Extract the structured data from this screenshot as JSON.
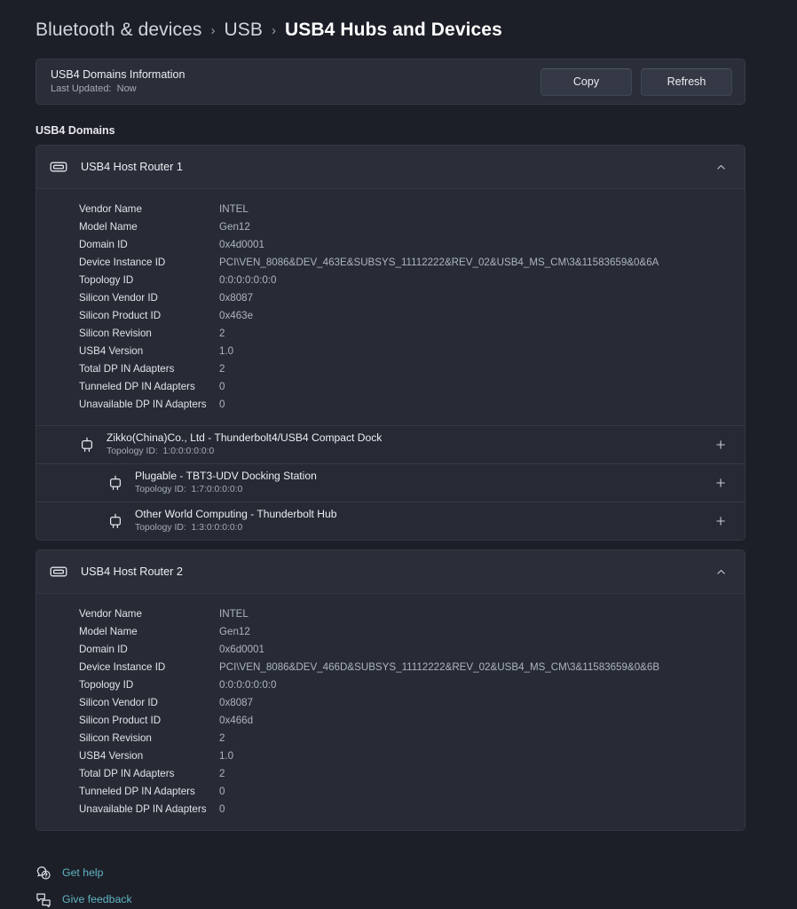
{
  "breadcrumb": {
    "items": [
      {
        "label": "Bluetooth & devices",
        "current": false
      },
      {
        "label": "USB",
        "current": false
      },
      {
        "label": "USB4 Hubs and Devices",
        "current": true
      }
    ],
    "separator": "›"
  },
  "info_card": {
    "title": "USB4 Domains Information",
    "last_updated_label": "Last Updated:",
    "last_updated_value": "Now",
    "copy_button": "Copy",
    "refresh_button": "Refresh"
  },
  "section": {
    "label": "USB4 Domains"
  },
  "routers": [
    {
      "name": "USB4 Host Router 1",
      "icon": "usb-port-icon",
      "expanded": true,
      "chevron": "chevron-up-icon",
      "properties": [
        {
          "key": "Vendor Name",
          "value": "INTEL"
        },
        {
          "key": "Model Name",
          "value": "Gen12"
        },
        {
          "key": "Domain ID",
          "value": "0x4d0001"
        },
        {
          "key": "Device Instance ID",
          "value": "PCI\\VEN_8086&DEV_463E&SUBSYS_11112222&REV_02&USB4_MS_CM\\3&11583659&0&6A"
        },
        {
          "key": "Topology ID",
          "value": "0:0:0:0:0:0:0"
        },
        {
          "key": "Silicon Vendor ID",
          "value": "0x8087"
        },
        {
          "key": "Silicon Product ID",
          "value": "0x463e"
        },
        {
          "key": "Silicon Revision",
          "value": "2"
        },
        {
          "key": "USB4 Version",
          "value": "1.0"
        },
        {
          "key": "Total DP IN Adapters",
          "value": "2"
        },
        {
          "key": "Tunneled DP IN Adapters",
          "value": "0"
        },
        {
          "key": "Unavailable DP IN Adapters",
          "value": "0"
        }
      ],
      "devices": [
        {
          "name": "Zikko(China)Co., Ltd - Thunderbolt4/USB4 Compact Dock",
          "topology_label": "Topology ID:",
          "topology_value": "1:0:0:0:0:0:0",
          "level": 1,
          "icon": "plug-icon",
          "expand": "plus-icon"
        },
        {
          "name": "Plugable - TBT3-UDV Docking Station",
          "topology_label": "Topology ID:",
          "topology_value": "1:7:0:0:0:0:0",
          "level": 2,
          "icon": "plug-icon",
          "expand": "plus-icon"
        },
        {
          "name": "Other World Computing - Thunderbolt Hub",
          "topology_label": "Topology ID:",
          "topology_value": "1:3:0:0:0:0:0",
          "level": 2,
          "icon": "plug-icon",
          "expand": "plus-icon"
        }
      ]
    },
    {
      "name": "USB4 Host Router 2",
      "icon": "usb-port-icon",
      "expanded": true,
      "chevron": "chevron-up-icon",
      "properties": [
        {
          "key": "Vendor Name",
          "value": "INTEL"
        },
        {
          "key": "Model Name",
          "value": "Gen12"
        },
        {
          "key": "Domain ID",
          "value": "0x6d0001"
        },
        {
          "key": "Device Instance ID",
          "value": "PCI\\VEN_8086&DEV_466D&SUBSYS_11112222&REV_02&USB4_MS_CM\\3&11583659&0&6B"
        },
        {
          "key": "Topology ID",
          "value": "0:0:0:0:0:0:0"
        },
        {
          "key": "Silicon Vendor ID",
          "value": "0x8087"
        },
        {
          "key": "Silicon Product ID",
          "value": "0x466d"
        },
        {
          "key": "Silicon Revision",
          "value": "2"
        },
        {
          "key": "USB4 Version",
          "value": "1.0"
        },
        {
          "key": "Total DP IN Adapters",
          "value": "2"
        },
        {
          "key": "Tunneled DP IN Adapters",
          "value": "0"
        },
        {
          "key": "Unavailable DP IN Adapters",
          "value": "0"
        }
      ],
      "devices": []
    }
  ],
  "footer": {
    "links": [
      {
        "label": "Get help",
        "icon": "help-icon"
      },
      {
        "label": "Give feedback",
        "icon": "feedback-icon"
      }
    ]
  },
  "colors": {
    "page_background": "#1c1f27",
    "card_background": "#2a2e39",
    "detail_background": "#272b35",
    "accent_link": "#5fb4c4",
    "primary_text": "#eceef2",
    "secondary_text": "#a5abb6"
  }
}
